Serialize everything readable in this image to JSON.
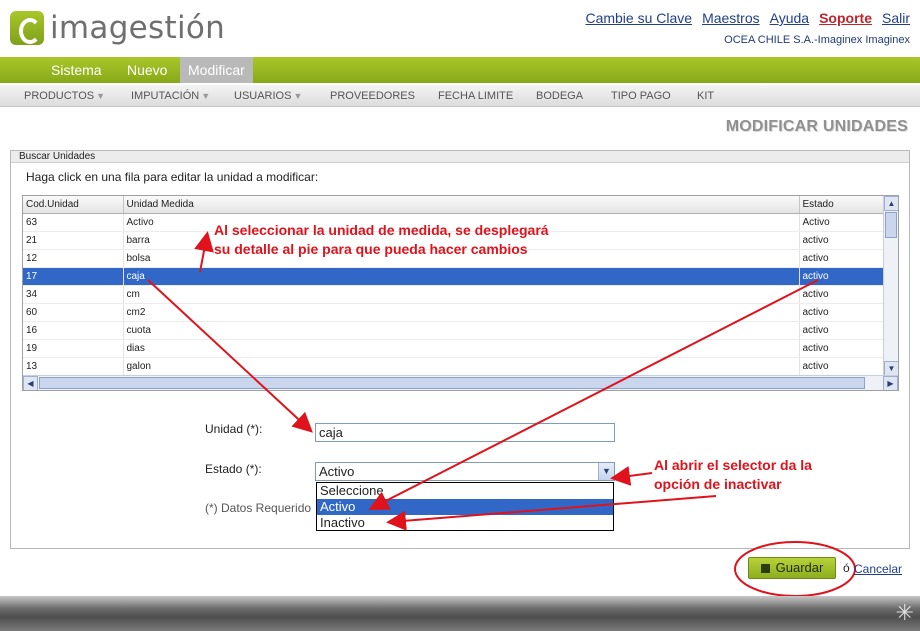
{
  "brand": {
    "name": "imagestión"
  },
  "toplinks": {
    "change_key": "Cambie su Clave",
    "masters": "Maestros",
    "help": "Ayuda",
    "support": "Soporte",
    "exit": "Salir"
  },
  "company": "OCEA CHILE S.A.-Imaginex Imaginex",
  "mainnav": [
    "Sistema",
    "Nuevo",
    "Modificar"
  ],
  "subnav": [
    "PRODUCTOS",
    "IMPUTACIÓN",
    "USUARIOS",
    "PROVEEDORES",
    "FECHA LIMITE",
    "BODEGA",
    "TIPO PAGO",
    "KIT"
  ],
  "page_title": "MODIFICAR UNIDADES",
  "panel": {
    "title": "Buscar Unidades",
    "instructions": "Haga click en una fila para editar la unidad a modificar:",
    "columns": [
      "Cod.Unidad",
      "Unidad Medida",
      "Estado"
    ],
    "rows": [
      [
        "63",
        "Activo",
        "Activo"
      ],
      [
        "21",
        "barra",
        "activo"
      ],
      [
        "12",
        "bolsa",
        "activo"
      ],
      [
        "17",
        "caja",
        "activo"
      ],
      [
        "34",
        "cm",
        "activo"
      ],
      [
        "60",
        "cm2",
        "activo"
      ],
      [
        "16",
        "cuota",
        "activo"
      ],
      [
        "19",
        "dias",
        "activo"
      ],
      [
        "13",
        "galon",
        "activo"
      ]
    ],
    "selected_row": 3
  },
  "form": {
    "unit_label": "Unidad (*):",
    "unit_value": "caja",
    "status_label": "Estado (*):",
    "status_value": "Activo",
    "status_options": [
      "Seleccione",
      "Activo",
      "Inactivo"
    ],
    "required_note": "(*) Datos Requerido"
  },
  "annotations": {
    "grid": [
      "Al seleccionar la unidad de medida, se desplegará",
      "su detalle al pie para que pueda hacer cambios"
    ],
    "select": [
      "Al abrir el selector da la",
      "opción de inactivar"
    ]
  },
  "actions": {
    "save": "Guardar",
    "or": "ó",
    "cancel": "Cancelar"
  },
  "colors": {
    "brand_green": "#9bbb22",
    "selection_blue": "#3168c8",
    "annotation_red": "#e0121b"
  }
}
